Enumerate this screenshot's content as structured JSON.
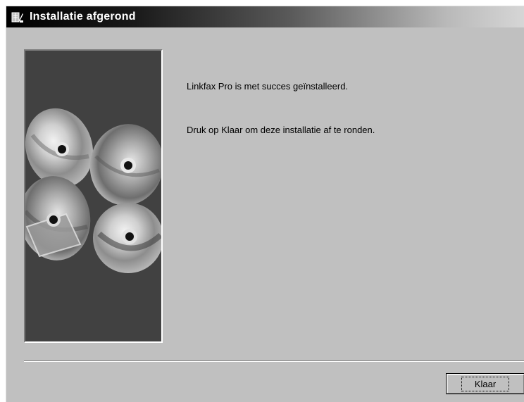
{
  "window": {
    "title": "Installatie afgerond",
    "icon": "setup-app-icon"
  },
  "side_panel": {
    "image": "cd-discs-illustration"
  },
  "messages": {
    "success": "Linkfax Pro is met succes geïnstalleerd.",
    "instruction": "Druk op Klaar om deze installatie af te ronden."
  },
  "buttons": {
    "finish_label": "Klaar"
  },
  "colors": {
    "dialog_bg": "#c0c0c0",
    "panel_bg": "#414141",
    "title_start": "#000000",
    "title_end": "#d6d6d6"
  }
}
